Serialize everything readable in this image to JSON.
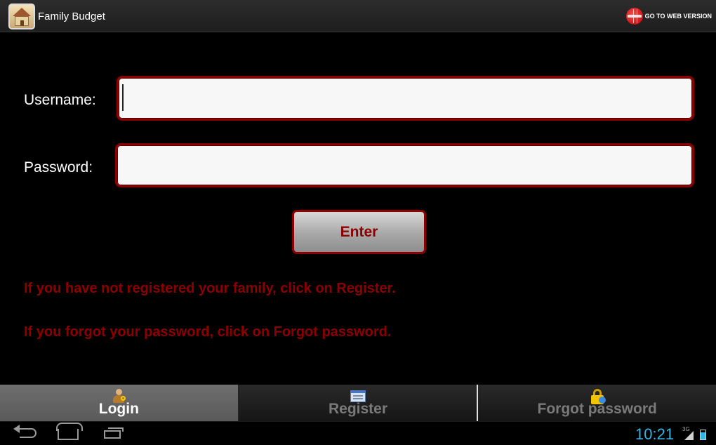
{
  "app": {
    "title": "Family Budget",
    "web_link_label": "GO TO WEB VERSION"
  },
  "form": {
    "username_label": "Username:",
    "username_value": "",
    "password_label": "Password:",
    "password_value": "",
    "enter_label": "Enter"
  },
  "messages": [
    "If you have not registered your family, click on Register.",
    "If you forgot your password, click on Forgot password."
  ],
  "tabs": [
    {
      "label": "Login",
      "icon": "login-user-key-icon",
      "active": true
    },
    {
      "label": "Register",
      "icon": "register-card-icon",
      "active": false
    },
    {
      "label": "Forgot password",
      "icon": "lock-help-icon",
      "active": false
    }
  ],
  "status": {
    "time": "10:21",
    "network": "3G"
  },
  "colors": {
    "accent": "#8b0000",
    "clock": "#33b5e5"
  }
}
